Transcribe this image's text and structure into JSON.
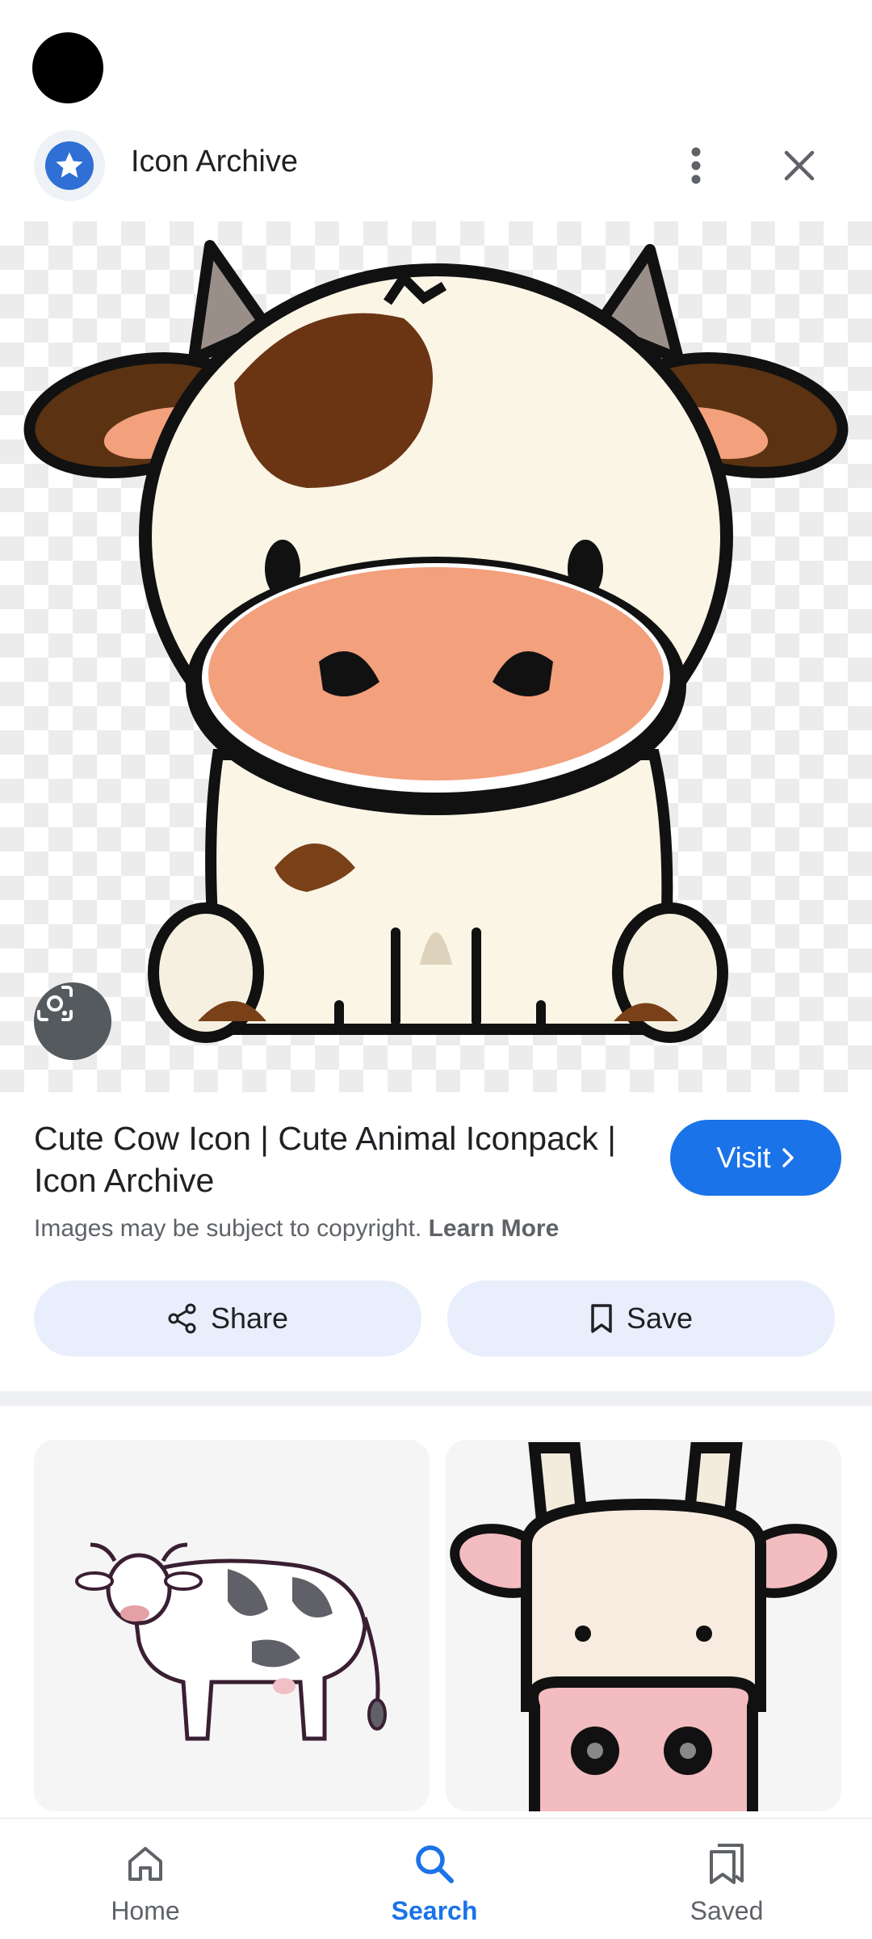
{
  "header": {
    "site_name": "Icon Archive",
    "site_icon": "star-logo-icon",
    "more_icon": "more-vert-icon",
    "close_icon": "close-icon"
  },
  "result": {
    "title": "Cute Cow Icon | Cute Animal Iconpack | Icon Archive",
    "visit_label": "Visit",
    "copyright_text": "Images may be subject to copyright.",
    "learn_more_label": "Learn More",
    "share_label": "Share",
    "save_label": "Save"
  },
  "related": [
    {
      "icon": "spotted-cow-image"
    },
    {
      "icon": "cow-face-image"
    }
  ],
  "bottom_nav": [
    {
      "label": "Home",
      "icon": "home-icon",
      "active": false
    },
    {
      "label": "Search",
      "icon": "search-icon",
      "active": true
    },
    {
      "label": "Saved",
      "icon": "saved-icon",
      "active": false
    }
  ],
  "colors": {
    "accent": "#1a73e8",
    "pill_bg": "#e8eefb",
    "lens_bg": "#555a5f"
  }
}
